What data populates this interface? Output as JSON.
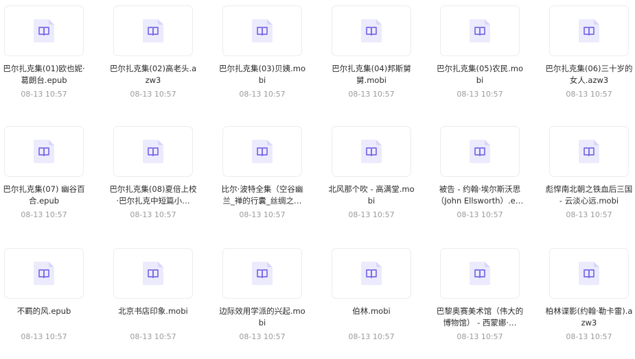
{
  "files": [
    {
      "name": "巴尔扎克集(01)欧也妮·葛朗台.epub",
      "date": "08-13 10:57"
    },
    {
      "name": "巴尔扎克集(02)高老头.azw3",
      "date": "08-13 10:57"
    },
    {
      "name": "巴尔扎克集(03)贝姨.mobi",
      "date": "08-13 10:57"
    },
    {
      "name": "巴尔扎克集(04)邦斯舅舅.mobi",
      "date": "08-13 10:57"
    },
    {
      "name": "巴尔扎克集(05)农民.mobi",
      "date": "08-13 10:57"
    },
    {
      "name": "巴尔扎克集(06)三十岁的女人.azw3",
      "date": "08-13 10:57"
    },
    {
      "name": "巴尔扎克集(07) 幽谷百合.epub",
      "date": "08-13 10:57"
    },
    {
      "name": "巴尔扎克集(08)夏倍上校·巴尔扎克中短篇小…",
      "date": "08-13 10:57"
    },
    {
      "name": "比尔·波特全集（空谷幽兰_禅的行囊_丝绸之…",
      "date": "08-13 10:57"
    },
    {
      "name": "北风那个吹 - 高满堂.mobi",
      "date": "08-13 10:57"
    },
    {
      "name": "被告 - 约翰·埃尔斯沃思（John Ellsworth）.e…",
      "date": "08-13 10:57"
    },
    {
      "name": "彪悍南北朝之铁血后三国 - 云淡心远.mobi",
      "date": "08-13 10:57"
    },
    {
      "name": "不羁的风.epub",
      "date": "08-13 10:57"
    },
    {
      "name": "北京书店印象.mobi",
      "date": "08-13 10:57"
    },
    {
      "name": "边际效用学派的兴起.mobi",
      "date": "08-13 10:57"
    },
    {
      "name": "伯林.mobi",
      "date": "08-13 10:57"
    },
    {
      "name": "巴黎奥赛美术馆（伟大的博物馆） - 西蒙娜·…",
      "date": "08-13 10:57"
    },
    {
      "name": "柏林谍影(约翰·勒卡雷).azw3",
      "date": "08-13 10:57"
    }
  ],
  "icon": "book-icon",
  "colors": {
    "icon_bg": "#ecebfd",
    "icon_fg": "#7868e6",
    "name_text": "#2b2b2b",
    "date_text": "#9a9a9a",
    "card_border": "#ececf0"
  }
}
